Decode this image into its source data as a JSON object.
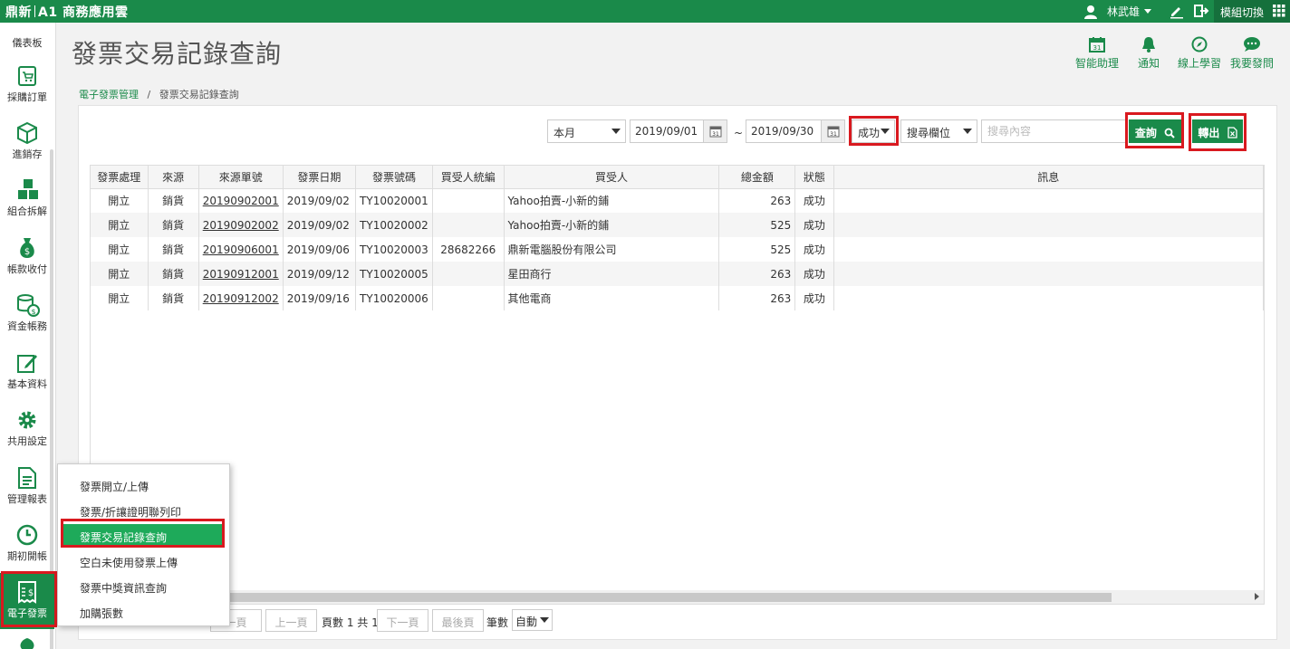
{
  "topbar": {
    "brand_a": "鼎新",
    "brand_b": "A1 商務應用雲",
    "user_name": "林武雄",
    "module_switch": "模組切換"
  },
  "sidebar": {
    "items": [
      {
        "label": "儀表板"
      },
      {
        "label": "採購訂單"
      },
      {
        "label": "進銷存"
      },
      {
        "label": "組合拆解"
      },
      {
        "label": "帳款收付"
      },
      {
        "label": "資金帳務"
      },
      {
        "label": "基本資料"
      },
      {
        "label": "共用設定"
      },
      {
        "label": "管理報表"
      },
      {
        "label": "期初開帳"
      },
      {
        "label": "電子發票"
      }
    ]
  },
  "header": {
    "title": "發票交易記錄查詢",
    "tools": [
      {
        "label": "智能助理",
        "icon": "calendar-icon"
      },
      {
        "label": "通知",
        "icon": "bell-icon"
      },
      {
        "label": "線上學習",
        "icon": "compass-icon"
      },
      {
        "label": "我要發問",
        "icon": "chat-icon"
      }
    ]
  },
  "breadcrumb": {
    "parent": "電子發票管理",
    "separator": "/",
    "current": "發票交易記錄查詢"
  },
  "filters": {
    "period": "本月",
    "date_from": "2019/09/01",
    "tilde": "~",
    "date_to": "2019/09/30",
    "status": "成功",
    "search_field": "搜尋欄位",
    "search_placeholder": "搜尋內容",
    "query_label": "查詢",
    "export_label": "轉出"
  },
  "table": {
    "columns": [
      "發票處理",
      "來源",
      "來源單號",
      "發票日期",
      "發票號碼",
      "買受人統編",
      "買受人",
      "總金額",
      "狀態",
      "訊息"
    ],
    "rows": [
      [
        "開立",
        "銷貨",
        "20190902001",
        "2019/09/02",
        "TY10020001",
        "",
        "Yahoo拍賣-小新的鋪",
        "263",
        "成功",
        ""
      ],
      [
        "開立",
        "銷貨",
        "20190902002",
        "2019/09/02",
        "TY10020002",
        "",
        "Yahoo拍賣-小新的鋪",
        "525",
        "成功",
        ""
      ],
      [
        "開立",
        "銷貨",
        "20190906001",
        "2019/09/06",
        "TY10020003",
        "28682266",
        "鼎新電腦股份有限公司",
        "525",
        "成功",
        ""
      ],
      [
        "開立",
        "銷貨",
        "20190912001",
        "2019/09/12",
        "TY10020005",
        "",
        "星田商行",
        "263",
        "成功",
        ""
      ],
      [
        "開立",
        "銷貨",
        "20190912002",
        "2019/09/16",
        "TY10020006",
        "",
        "其他電商",
        "263",
        "成功",
        ""
      ]
    ]
  },
  "pager": {
    "first": "一頁",
    "prev": "上一頁",
    "page_info": "頁數 1 共 1",
    "next": "下一頁",
    "last": "最後頁",
    "count_label": "筆數",
    "count_value": "自動"
  },
  "popup": {
    "items": [
      {
        "label": "發票開立/上傳"
      },
      {
        "label": "發票/折讓證明聯列印"
      },
      {
        "label": "發票交易記錄查詢"
      },
      {
        "label": "空白未使用發票上傳"
      },
      {
        "label": "發票中獎資訊查詢"
      },
      {
        "label": "加購張數"
      }
    ]
  },
  "colors": {
    "brand": "#1a8a4a",
    "highlight": "#d9191f",
    "menu_active": "#1eaa5a"
  }
}
